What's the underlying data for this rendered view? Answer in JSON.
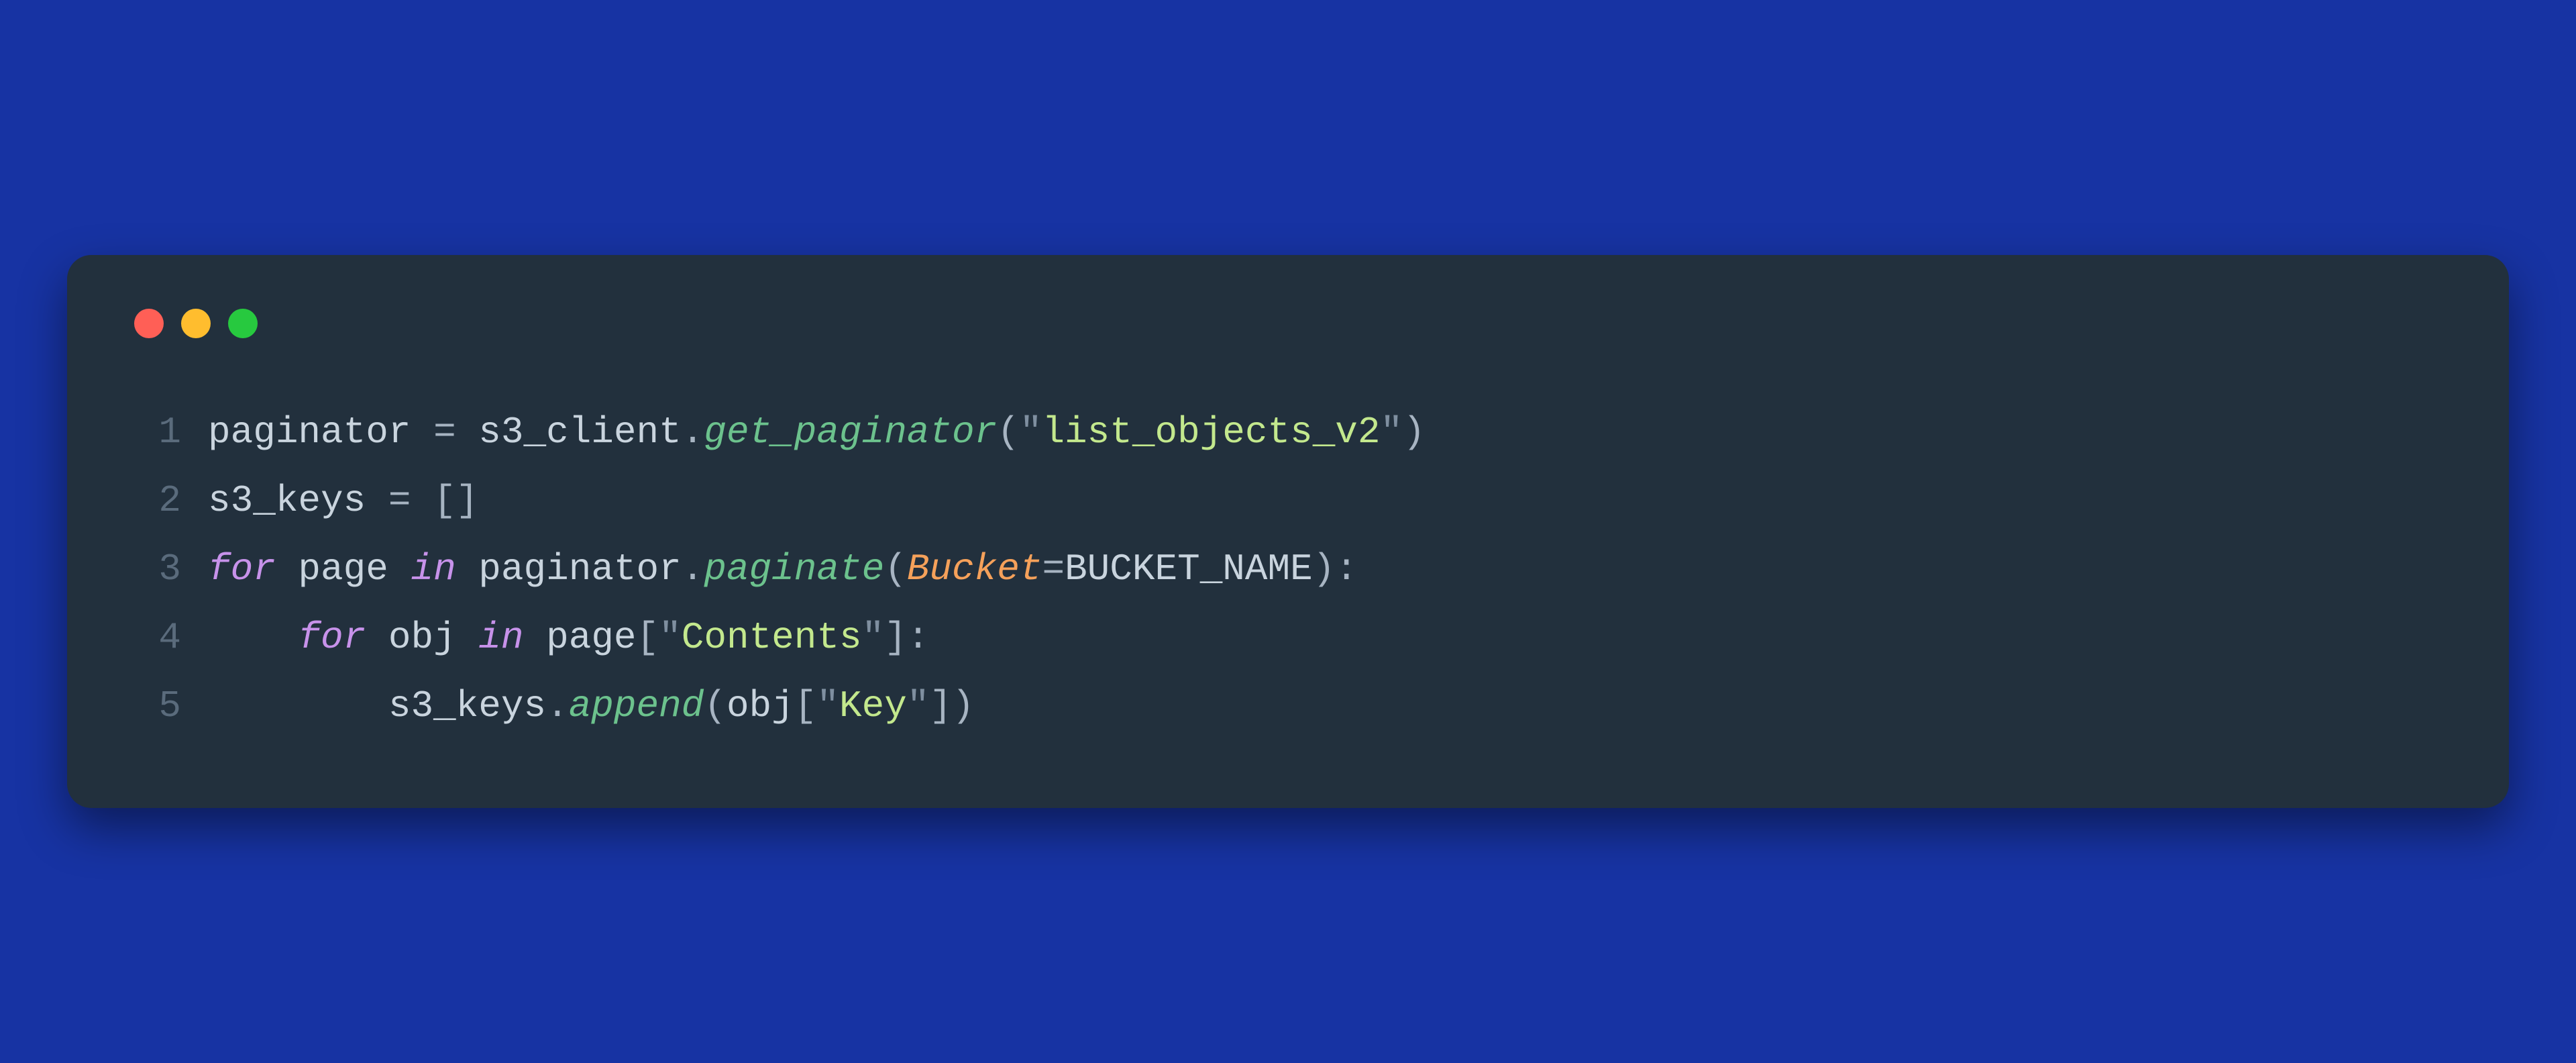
{
  "window": {
    "dots": [
      "red",
      "yellow",
      "green"
    ]
  },
  "code": {
    "lines": [
      {
        "num": "1",
        "tokens": [
          {
            "cls": "tok-plain",
            "text": "paginator "
          },
          {
            "cls": "tok-operator",
            "text": "="
          },
          {
            "cls": "tok-plain",
            "text": " s3_client"
          },
          {
            "cls": "tok-punct",
            "text": "."
          },
          {
            "cls": "tok-method",
            "text": "get_paginator"
          },
          {
            "cls": "tok-punct",
            "text": "("
          },
          {
            "cls": "tok-quote",
            "text": "\""
          },
          {
            "cls": "tok-string",
            "text": "list_objects_v2"
          },
          {
            "cls": "tok-quote",
            "text": "\""
          },
          {
            "cls": "tok-punct",
            "text": ")"
          }
        ]
      },
      {
        "num": "2",
        "tokens": [
          {
            "cls": "tok-plain",
            "text": "s3_keys "
          },
          {
            "cls": "tok-operator",
            "text": "="
          },
          {
            "cls": "tok-plain",
            "text": " "
          },
          {
            "cls": "tok-punct",
            "text": "[]"
          }
        ]
      },
      {
        "num": "3",
        "tokens": [
          {
            "cls": "tok-keyword",
            "text": "for"
          },
          {
            "cls": "tok-plain",
            "text": " page "
          },
          {
            "cls": "tok-keyword",
            "text": "in"
          },
          {
            "cls": "tok-plain",
            "text": " paginator"
          },
          {
            "cls": "tok-punct",
            "text": "."
          },
          {
            "cls": "tok-method",
            "text": "paginate"
          },
          {
            "cls": "tok-punct",
            "text": "("
          },
          {
            "cls": "tok-param",
            "text": "Bucket"
          },
          {
            "cls": "tok-operator",
            "text": "="
          },
          {
            "cls": "tok-const",
            "text": "BUCKET_NAME"
          },
          {
            "cls": "tok-punct",
            "text": "):"
          }
        ]
      },
      {
        "num": "4",
        "tokens": [
          {
            "cls": "tok-plain",
            "text": "    "
          },
          {
            "cls": "tok-keyword",
            "text": "for"
          },
          {
            "cls": "tok-plain",
            "text": " obj "
          },
          {
            "cls": "tok-keyword",
            "text": "in"
          },
          {
            "cls": "tok-plain",
            "text": " page"
          },
          {
            "cls": "tok-punct",
            "text": "["
          },
          {
            "cls": "tok-quote",
            "text": "\""
          },
          {
            "cls": "tok-string",
            "text": "Contents"
          },
          {
            "cls": "tok-quote",
            "text": "\""
          },
          {
            "cls": "tok-punct",
            "text": "]:"
          }
        ]
      },
      {
        "num": "5",
        "tokens": [
          {
            "cls": "tok-plain",
            "text": "        s3_keys"
          },
          {
            "cls": "tok-punct",
            "text": "."
          },
          {
            "cls": "tok-method",
            "text": "append"
          },
          {
            "cls": "tok-punct",
            "text": "("
          },
          {
            "cls": "tok-plain",
            "text": "obj"
          },
          {
            "cls": "tok-punct",
            "text": "["
          },
          {
            "cls": "tok-quote",
            "text": "\""
          },
          {
            "cls": "tok-string",
            "text": "Key"
          },
          {
            "cls": "tok-quote",
            "text": "\""
          },
          {
            "cls": "tok-punct",
            "text": "])"
          }
        ]
      }
    ]
  }
}
